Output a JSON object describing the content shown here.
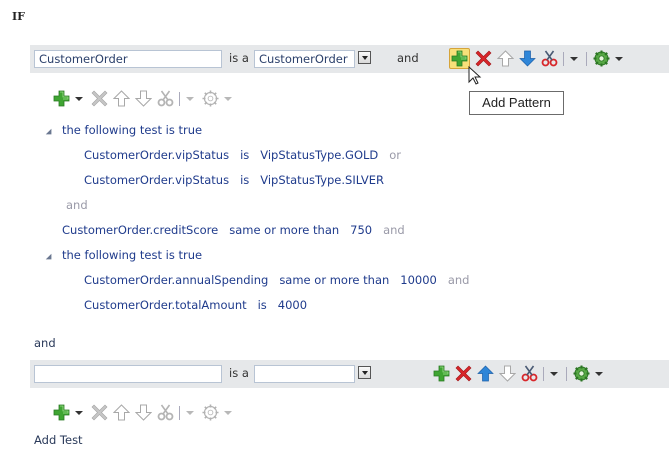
{
  "if_label": "IF",
  "pattern1": {
    "alias_value": "CustomerOrder",
    "is_a": "is a",
    "type_value": "CustomerOrder",
    "connector": "and"
  },
  "tooltip": "Add Pattern",
  "tests": {
    "group1_label": "the following test is true",
    "group1_lines": [
      {
        "left": "CustomerOrder.vipStatus",
        "op": "is",
        "right": "VipStatusType.GOLD",
        "conj": "or"
      },
      {
        "left": "CustomerOrder.vipStatus",
        "op": "is",
        "right": "VipStatusType.SILVER",
        "conj": ""
      }
    ],
    "and1": "and",
    "credit_line": {
      "left": "CustomerOrder.creditScore",
      "op": "same or more than",
      "right": "750",
      "conj": "and"
    },
    "group2_label": "the following test is true",
    "group2_lines": [
      {
        "left": "CustomerOrder.annualSpending",
        "op": "same or more than",
        "right": "10000",
        "conj": "and"
      },
      {
        "left": "CustomerOrder.totalAmount",
        "op": "is",
        "right": "4000",
        "conj": ""
      }
    ]
  },
  "and_between": "and",
  "pattern2": {
    "alias_value": "",
    "is_a": "is a",
    "type_value": ""
  },
  "add_test": "Add Test",
  "colors": {
    "accent_green": "#3fa532",
    "delete_red": "#d8262a",
    "up_blue": "#2f86d8",
    "highlight": "#f8e07a"
  }
}
